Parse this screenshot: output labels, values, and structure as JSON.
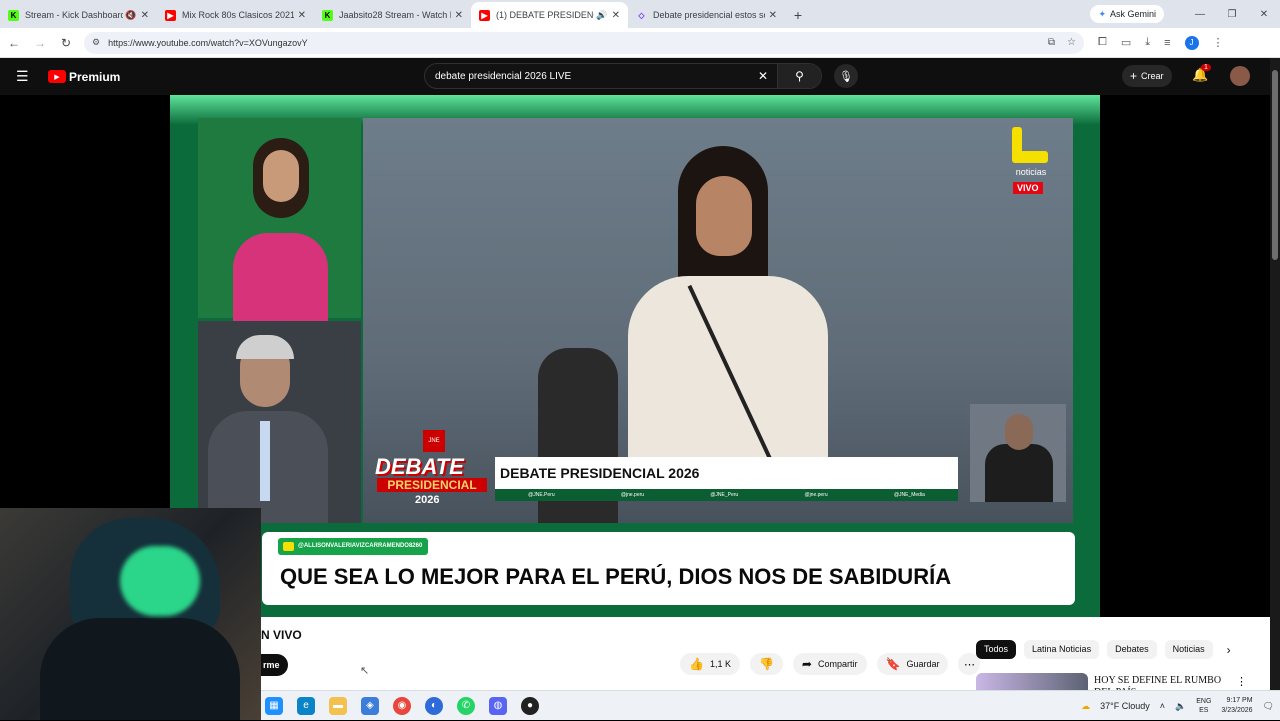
{
  "browser": {
    "tabs": [
      {
        "title": "Stream - Kick Dashboard",
        "favicon_color": "#53fc18",
        "favicon": "K",
        "muted": true,
        "active": false
      },
      {
        "title": "Mix Rock 80s Clasicos 2021 dj d",
        "favicon_color": "#ff0000",
        "favicon": "▶",
        "active": false
      },
      {
        "title": "Jaabsito28 Stream - Watch Live",
        "favicon_color": "#53fc18",
        "favicon": "K",
        "active": false
      },
      {
        "title": "(1) DEBATE PRESIDENCIAL",
        "favicon_color": "#ff0000",
        "favicon": "▶",
        "audio": true,
        "active": true
      },
      {
        "title": "Debate presidencial estos son",
        "favicon_color": "#7a3cff",
        "favicon": "◇",
        "active": false
      }
    ],
    "new_tab_icon": "plus-icon",
    "gemini_label": "Ask Gemini",
    "url": "https://www.youtube.com/watch?v=XOVungazovY",
    "profile_initial": "J"
  },
  "youtube": {
    "brand": "Premium",
    "search_query": "debate presidencial 2026 LIVE",
    "create_label": "Crear",
    "notification_count": "1"
  },
  "video": {
    "network_logo_text": "noticias",
    "live_badge": "VIVO",
    "debate_logo": {
      "line1": "DEBATE",
      "line2": "PRESIDENCIAL",
      "line3": "2026",
      "emblem": "JNE"
    },
    "lower_third_title": "DEBATE PRESIDENCIAL 2026",
    "socials": [
      "@JNE.Peru",
      "@jne.peru",
      "@JNE_Peru",
      "@jne.peru",
      "@JNE_Media"
    ],
    "comment_user": "@ALLISONVALERIAVIZCARRAMENDO8260",
    "comment_text": "QUE SEA LO MEJOR PARA EL PERÚ, DIOS NOS DE SABIDURÍA"
  },
  "watch": {
    "title_fragment": "N VIVO",
    "subscribe_fragment": "rme",
    "like_count": "1,1 K",
    "share_label": "Compartir",
    "save_label": "Guardar",
    "chips": [
      "Todos",
      "Latina Noticias",
      "Debates",
      "Noticias"
    ],
    "recommended_title": "HOY SE DEFINE EL RUMBO DEL PAÍS"
  },
  "taskbar": {
    "weather": "37°F  Cloudy",
    "lang_top": "ENG",
    "lang_bottom": "ES",
    "time": "9:17 PM",
    "date": "3/23/2026"
  }
}
